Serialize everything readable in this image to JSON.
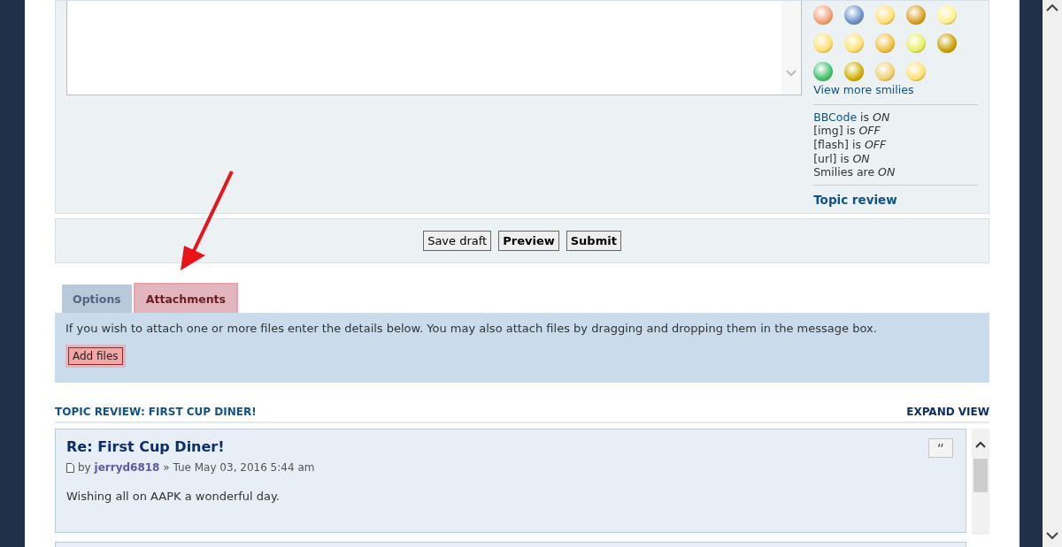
{
  "editor": {
    "smilies_link": "View more smilies",
    "statuses": [
      {
        "name": "BBCode",
        "link": true,
        "rest": "is *ON*"
      },
      {
        "name": "[img]",
        "link": false,
        "rest": "is *OFF*"
      },
      {
        "name": "[flash]",
        "link": false,
        "rest": "is *OFF*"
      },
      {
        "name": "[url]",
        "link": false,
        "rest": "is *ON*"
      },
      {
        "name": "Smilies",
        "link": false,
        "rest": "are *ON*"
      }
    ],
    "topic_review_link": "Topic review"
  },
  "buttons": [
    {
      "label": "Save draft",
      "primary": false
    },
    {
      "label": "Preview",
      "primary": true
    },
    {
      "label": "Submit",
      "primary": true
    }
  ],
  "tabs": [
    {
      "label": "Options",
      "selected": false
    },
    {
      "label": "Attachments",
      "selected": true
    }
  ],
  "attachments": {
    "help": "If you wish to attach one or more files enter the details below. You may also attach files by dragging and dropping them in the message box.",
    "add_button": "Add files"
  },
  "topic_review": {
    "title": "TOPIC REVIEW: FIRST CUP DINER!",
    "expand": "EXPAND VIEW",
    "posts": [
      {
        "title": "Re: First Cup Diner!",
        "by": "by",
        "author": "jerryd6818",
        "date": "» Tue May 03, 2016 5:44 am",
        "body": "Wishing all on AAPK a wonderful day.",
        "quote": "“"
      }
    ]
  }
}
